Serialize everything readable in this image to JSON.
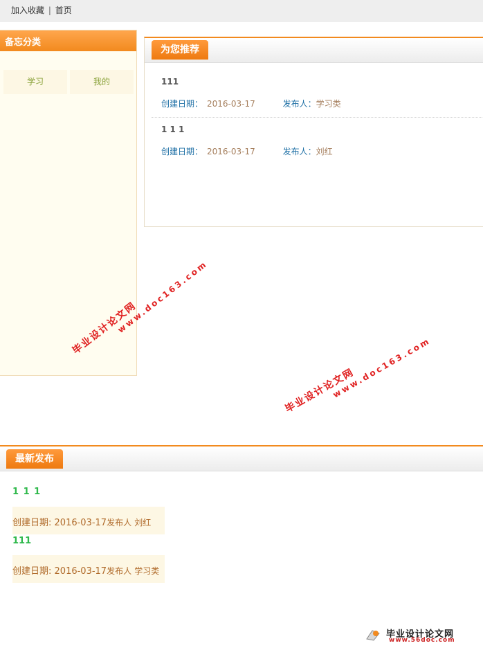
{
  "topbar": {
    "add_favorite": "加入收藏",
    "separator": "|",
    "home": "首页"
  },
  "sidebar": {
    "title": "备忘分类",
    "categories": [
      "学习",
      "我的"
    ]
  },
  "recommend": {
    "title": "为您推荐",
    "items": [
      {
        "title": "111",
        "date_label": "创建日期：",
        "date": "2016-03-17",
        "author_label": "发布人：",
        "author": "学习类"
      },
      {
        "title": "1 1 1",
        "date_label": "创建日期：",
        "date": "2016-03-17",
        "author_label": "发布人：",
        "author": "刘红"
      }
    ]
  },
  "watermark": {
    "line1": "毕业设计论文网",
    "line2": "www.doc163.com"
  },
  "latest": {
    "title": "最新发布",
    "items": [
      {
        "title": "1 1 1",
        "date_label": "创建日期:",
        "date": "2016-03-17",
        "author_label": "发布人",
        "author": "刘红"
      },
      {
        "title": "111",
        "date_label": "创建日期:",
        "date": "2016-03-17",
        "author_label": "发布人",
        "author": "学习类"
      }
    ]
  },
  "logo": {
    "name": "毕业设计论文网",
    "url": "www.56doc.com"
  },
  "colors": {
    "accent": "#f28a1e",
    "link_blue": "#1d6fa5",
    "green_title": "#2db84a",
    "watermark_red": "#e02020"
  }
}
